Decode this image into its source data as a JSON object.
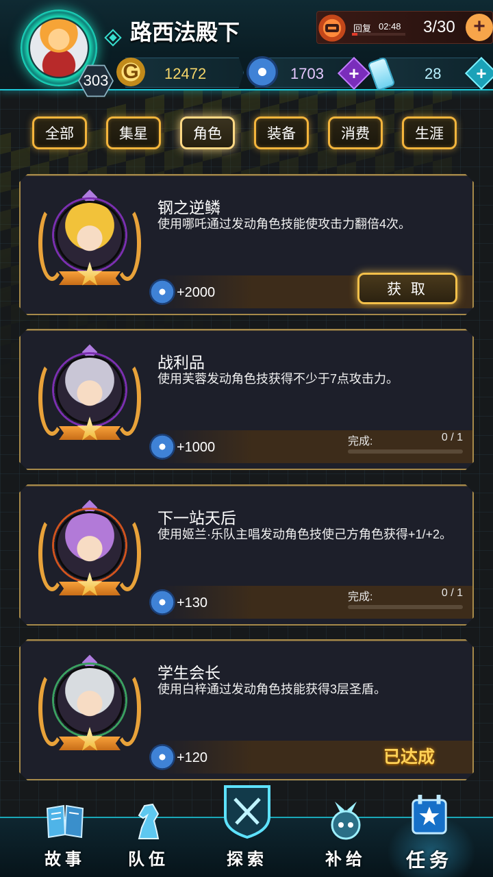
{
  "player": {
    "name": "路西法殿下",
    "level": "303"
  },
  "stamina": {
    "label": "回复",
    "timer": "02:48",
    "count": "3/30",
    "fraction": 0.1
  },
  "resources": {
    "gold": "12472",
    "gems": "1703",
    "bottles": "28"
  },
  "tabs": [
    {
      "label": "全部",
      "active": false
    },
    {
      "label": "集星",
      "active": false
    },
    {
      "label": "角色",
      "active": true
    },
    {
      "label": "装备",
      "active": false
    },
    {
      "label": "消费",
      "active": false
    },
    {
      "label": "生涯",
      "active": false
    }
  ],
  "quests": [
    {
      "title": "钢之逆鳞",
      "description": "使用哪吒通过发动角色技能使攻击力翻倍4次。",
      "reward": "+2000",
      "status": "claim",
      "claim_label": "获 取",
      "portrait_color": "#f2c23a",
      "ring_color": "#7b2fb0"
    },
    {
      "title": "战利品",
      "description": "使用芙蓉发动角色技获得不少于7点攻击力。",
      "reward": "+1000",
      "status": "progress",
      "progress_label": "完成:",
      "progress_value": "0 / 1",
      "progress_fraction": 0,
      "portrait_color": "#c9c6d6",
      "ring_color": "#7b2fb0"
    },
    {
      "title": "下一站天后",
      "description": "使用姬兰·乐队主唱发动角色技使己方角色获得+1/+2。",
      "reward": "+130",
      "status": "progress",
      "progress_label": "完成:",
      "progress_value": "0 / 1",
      "progress_fraction": 0,
      "portrait_color": "#b27ad8",
      "ring_color": "#d0531e"
    },
    {
      "title": "学生会长",
      "description": "使用白梓通过发动角色技能获得3层圣盾。",
      "reward": "+120",
      "status": "achieved",
      "achieved_label": "已达成",
      "portrait_color": "#d8dce0",
      "ring_color": "#3aa060"
    }
  ],
  "nav": [
    {
      "label": "故事",
      "icon": "book-icon",
      "active": false
    },
    {
      "label": "队伍",
      "icon": "knight-icon",
      "active": false
    },
    {
      "label": "探索",
      "icon": "crossed-swords-icon",
      "active": false
    },
    {
      "label": "补给",
      "icon": "robot-icon",
      "active": false
    },
    {
      "label": "任务",
      "icon": "star-calendar-icon",
      "active": true
    }
  ],
  "colors": {
    "accent_gold": "#f4b53c",
    "accent_cyan": "#1ec8d8",
    "card_bg": "#1d1f2a"
  }
}
